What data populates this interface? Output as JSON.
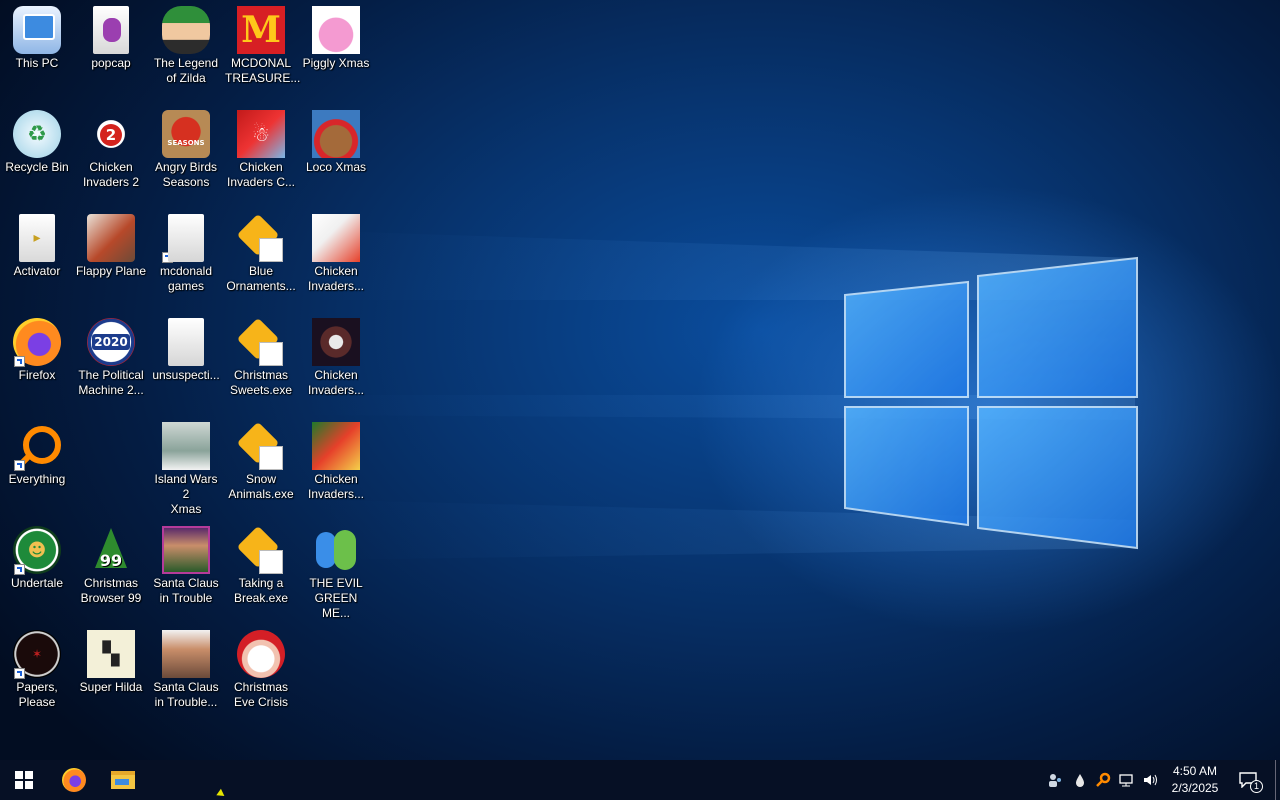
{
  "desktop": {
    "icons": [
      {
        "label": "This PC"
      },
      {
        "label": "popcap"
      },
      {
        "label": "The Legend\nof Zilda"
      },
      {
        "label": "MCDONAL\nTREASURE..."
      },
      {
        "label": "Piggly Xmas"
      },
      {
        "label": "Recycle Bin"
      },
      {
        "label": "Chicken\nInvaders 2"
      },
      {
        "label": "Angry Birds\nSeasons"
      },
      {
        "label": "Chicken\nInvaders C..."
      },
      {
        "label": "Loco Xmas"
      },
      {
        "label": "Activator"
      },
      {
        "label": "Flappy Plane"
      },
      {
        "label": "mcdonald\ngames"
      },
      {
        "label": "Blue\nOrnaments..."
      },
      {
        "label": "Chicken\nInvaders..."
      },
      {
        "label": "Firefox"
      },
      {
        "label": "The Political\nMachine 2..."
      },
      {
        "label": "unsuspecti..."
      },
      {
        "label": "Christmas\nSweets.exe"
      },
      {
        "label": "Chicken\nInvaders..."
      },
      {
        "label": "Everything"
      },
      {
        "label": "Island Wars 2\nXmas"
      },
      {
        "label": "Snow\nAnimals.exe"
      },
      {
        "label": "Chicken\nInvaders..."
      },
      {
        "label": "Undertale"
      },
      {
        "label": "Christmas\nBrowser 99"
      },
      {
        "label": "Santa Claus\nin Trouble"
      },
      {
        "label": "Taking a\nBreak.exe"
      },
      {
        "label": "THE EVIL\nGREEN ME..."
      },
      {
        "label": "Papers,\nPlease"
      },
      {
        "label": "Super Hilda"
      },
      {
        "label": "Santa Claus\nin Trouble..."
      },
      {
        "label": "Christmas\nEve Crisis"
      }
    ]
  },
  "badges": {
    "chicken_invaders_2": "2",
    "angry_birds": "SEASONS",
    "political_machine": "2020",
    "christmas_browser": "99"
  },
  "taskbar": {
    "pinned": [
      "firefox-icon",
      "file-explorer-icon"
    ],
    "tray": [
      "people-icon",
      "drop-icon",
      "search-icon",
      "network-icon",
      "volume-icon"
    ],
    "time": "4:50 AM",
    "date": "2/3/2025",
    "notification_count": "1"
  },
  "colors": {
    "taskbar": "#061025",
    "accent": "#0a4d9e"
  }
}
